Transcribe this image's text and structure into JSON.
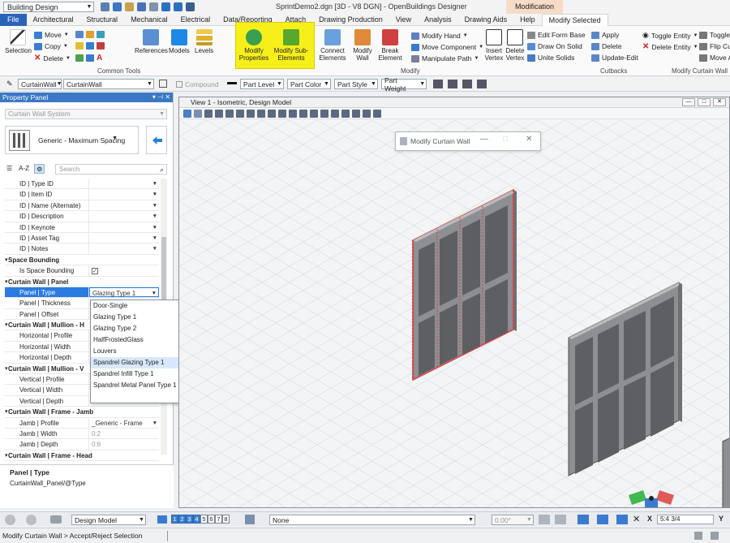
{
  "titlebar": {
    "workspace": "Building Design",
    "app_title": "SprintDemo2.dgn [3D - V8 DGN] - OpenBuildings Designer",
    "contextual_label": "Modification"
  },
  "tabs": [
    "File",
    "Architectural",
    "Structural",
    "Mechanical",
    "Electrical",
    "Data/Reporting",
    "Attach",
    "Drawing Production",
    "View",
    "Analysis",
    "Drawing Aids",
    "Help",
    "Modify Selected"
  ],
  "ribbon": {
    "selection": "Selection",
    "move": "Move",
    "copy": "Copy",
    "delete": "Delete",
    "common_tools": "Common Tools",
    "references": "References",
    "models": "Models",
    "levels": "Levels",
    "modify_properties": "Modify Properties",
    "modify_sub_elements": "Modify Sub-Elements",
    "connect_elements": "Connect Elements",
    "modify_wall": "Modify Wall",
    "break_element": "Break Element",
    "modify_hand": "Modify Hand",
    "move_component": "Move Component",
    "manipulate_path": "Manipulate Path",
    "modify_group": "Modify",
    "insert_vertex": "Insert Vertex",
    "delete_vertex": "Delete Vertex",
    "edit_form_base": "Edit Form Base",
    "draw_on_solid": "Draw On Solid",
    "unite_solids": "Unite Solids",
    "apply": "Apply",
    "cut_delete": "Delete",
    "update_edit": "Update-Edit",
    "cutbacks": "Cutbacks",
    "toggle_entity": "Toggle Entity",
    "delete_entity": "Delete Entity",
    "toggle_h": "Toggle H",
    "flip_cur": "Flip Cur",
    "move_a": "Move A",
    "modify_curtain_wall": "Modify Curtain Wall"
  },
  "attrbar": {
    "family": "CurtainWall",
    "part": "CurtainWall",
    "compound": "Compound",
    "part_level": "Part Level",
    "part_color": "Part Color",
    "part_style": "Part Style",
    "part_weight": "Part Weight"
  },
  "property_panel": {
    "title": "Property Panel",
    "class": "Curtain Wall System",
    "type": "Generic - Maximum Spacing",
    "search_placeholder": "Search",
    "az": "A-Z",
    "rows": [
      {
        "k": "ID | Type ID",
        "v": ""
      },
      {
        "k": "ID | Item ID",
        "v": ""
      },
      {
        "k": "ID | Name (Alternate)",
        "v": ""
      },
      {
        "k": "ID | Description",
        "v": ""
      },
      {
        "k": "ID | Keynote",
        "v": ""
      },
      {
        "k": "ID | Asset Tag",
        "v": ""
      },
      {
        "k": "ID | Notes",
        "v": ""
      }
    ],
    "sec_space": "Space Bounding",
    "is_space_bounding": "Is Space Bounding",
    "sec_panel": "Curtain Wall | Panel",
    "panel_type": "Panel | Type",
    "panel_type_value": "Glazing Type 1",
    "panel_thickness": "Panel | Thickness",
    "panel_offset": "Panel | Offset",
    "sec_mullion_h": "Curtain Wall | Mullion - H",
    "h_profile": "Horizontal | Profile",
    "h_width": "Horizontal | Width",
    "h_depth": "Horizontal | Depth",
    "sec_mullion_v": "Curtain Wall | Mullion - V",
    "v_profile": "Vertical | Profile",
    "v_width": "Vertical | Width",
    "v_depth": "Vertical | Depth",
    "v_depth_value": "0:6",
    "sec_jamb": "Curtain Wall | Frame - Jamb",
    "jamb_profile": "Jamb | Profile",
    "jamb_profile_value": "_Generic - Frame",
    "jamb_width": "Jamb | Width",
    "jamb_width_value": "0:2",
    "jamb_depth": "Jamb | Depth",
    "jamb_depth_value": "0:6",
    "sec_head": "Curtain Wall | Frame - Head",
    "desc_title": "Panel | Type",
    "desc_text": "CurtainWall_Panel/@Type"
  },
  "dropdown_options": [
    "Door-Single",
    "Glazing Type 1",
    "Glazing Type 2",
    "HalfFrostedGlass",
    "Louvers",
    "Spandrel Glazing Type 1",
    "Spandrel Infill Type 1",
    "Spandrel Metal Panel Type 1"
  ],
  "view": {
    "title": "View 1 - Isometric, Design Model"
  },
  "dialog": {
    "title": "Modify Curtain Wall"
  },
  "bottom": {
    "model": "Design Model",
    "views": [
      "1",
      "2",
      "3",
      "4",
      "5",
      "6",
      "7",
      "8"
    ],
    "level": "None",
    "angle": "0.00°",
    "x_label": "X",
    "x_value": "5:4 3/4",
    "y_label": "Y",
    "status": "Modify Curtain Wall > Accept/Reject Selection"
  },
  "colors": {
    "file_tab": "#2b63b8",
    "contextual": "#f6dcc6",
    "highlight": "#f7ef1a",
    "selection": "#2b7be0",
    "panel_header": "#3a78c5"
  }
}
